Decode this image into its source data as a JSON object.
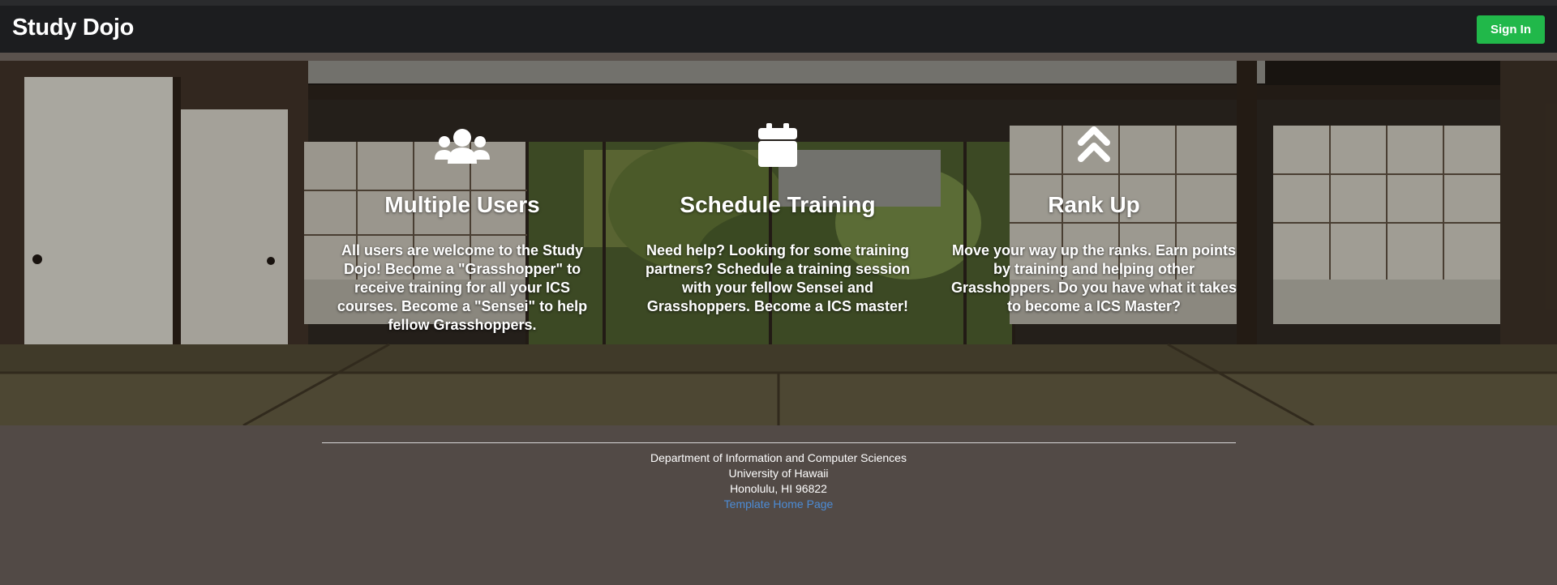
{
  "navbar": {
    "brand": "Study Dojo",
    "signin_label": "Sign In"
  },
  "features": [
    {
      "icon": "users-icon",
      "title": "Multiple Users",
      "text": "All users are welcome to the Study Dojo! Become a \"Grasshopper\" to receive training for all your ICS courses. Become a \"Sensei\" to help fellow Grasshoppers."
    },
    {
      "icon": "calendar-icon",
      "title": "Schedule Training",
      "text": "Need help? Looking for some training partners? Schedule a training session with your fellow Sensei and Grasshoppers. Become a ICS master!"
    },
    {
      "icon": "chevron-double-up-icon",
      "title": "Rank Up",
      "text": "Move your way up the ranks. Earn points by training and helping other Grasshoppers. Do you have what it takes to become a ICS Master?"
    }
  ],
  "footer": {
    "line1": "Department of Information and Computer Sciences",
    "line2": "University of Hawaii",
    "line3": "Honolulu, HI 96822",
    "link": "Template Home Page"
  },
  "colors": {
    "navbar_bg": "#1c1d1f",
    "signin_bg": "#21b84a",
    "footer_bg": "#524a46",
    "link": "#4c8cd6"
  }
}
